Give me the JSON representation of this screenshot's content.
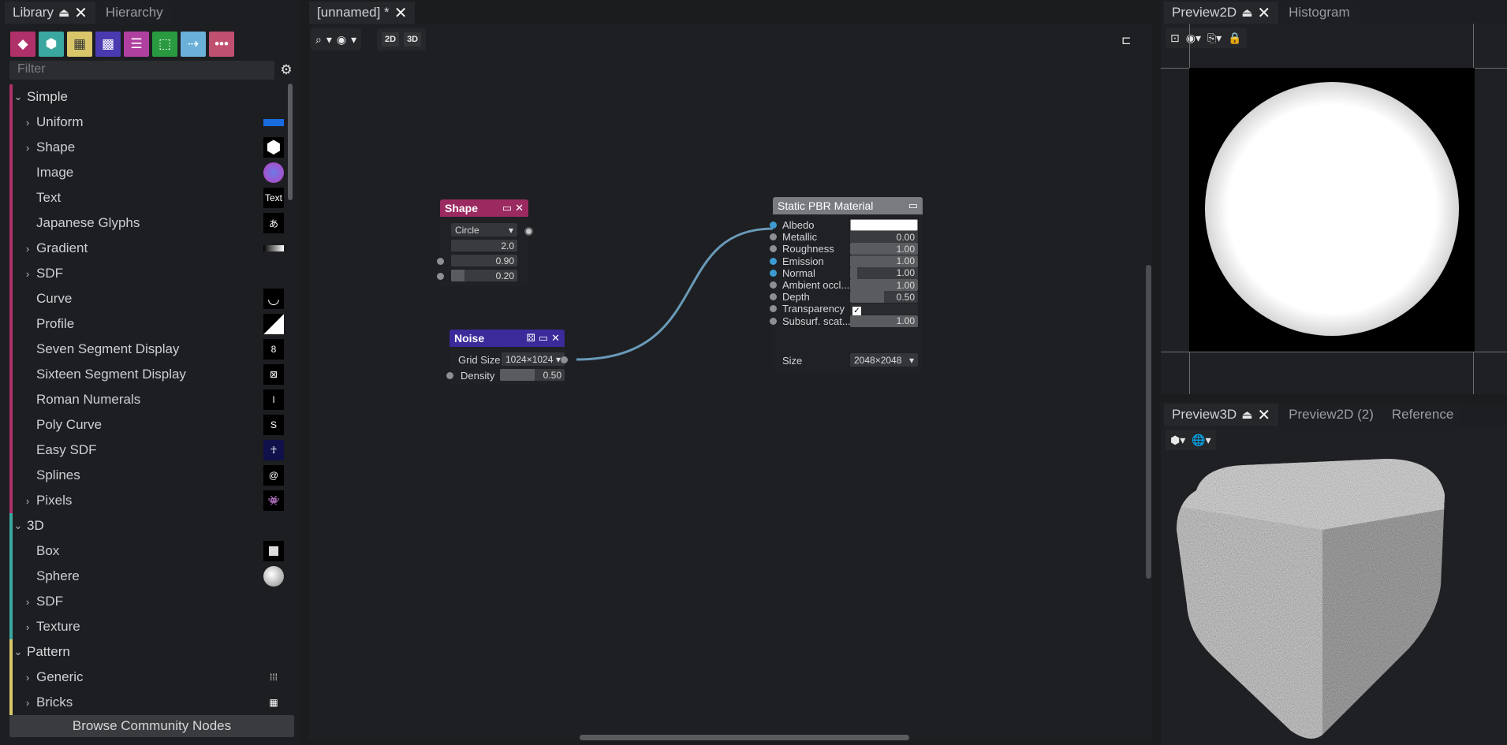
{
  "library_panel": {
    "tabs": [
      {
        "label": "Library",
        "active": true
      },
      {
        "label": "Hierarchy",
        "active": false
      }
    ],
    "filter_placeholder": "Filter",
    "category_icons": [
      {
        "name": "simple-shapes-icon",
        "color": "#b0306a"
      },
      {
        "name": "cube-icon",
        "color": "#3aa8a0"
      },
      {
        "name": "bricks-icon",
        "color": "#d9c66a"
      },
      {
        "name": "noise-icon",
        "color": "#4a3ab0"
      },
      {
        "name": "sliders-icon",
        "color": "#b040a0"
      },
      {
        "name": "selection-icon",
        "color": "#2a9a40"
      },
      {
        "name": "flow-icon",
        "color": "#6ab0d8"
      },
      {
        "name": "more-icon",
        "color": "#c05070"
      }
    ],
    "tree": [
      {
        "label": "Simple",
        "level": 0,
        "expanded": true,
        "color": "#b0306a"
      },
      {
        "label": "Uniform",
        "level": 1,
        "chev": true,
        "thumb": "uniform"
      },
      {
        "label": "Shape",
        "level": 1,
        "chev": true,
        "thumb": "hexagon"
      },
      {
        "label": "Image",
        "level": 1,
        "chev": false,
        "thumb": "image"
      },
      {
        "label": "Text",
        "level": 1,
        "chev": false,
        "thumb": "text",
        "thumb_text": "Text"
      },
      {
        "label": "Japanese Glyphs",
        "level": 1,
        "chev": false,
        "thumb": "glyph",
        "thumb_text": "あ"
      },
      {
        "label": "Gradient",
        "level": 1,
        "chev": true,
        "thumb": "gradient"
      },
      {
        "label": "SDF",
        "level": 1,
        "chev": true,
        "thumb": "none"
      },
      {
        "label": "Curve",
        "level": 1,
        "chev": false,
        "thumb": "curve"
      },
      {
        "label": "Profile",
        "level": 1,
        "chev": false,
        "thumb": "profile"
      },
      {
        "label": "Seven Segment Display",
        "level": 1,
        "chev": false,
        "thumb": "seg",
        "thumb_text": "8"
      },
      {
        "label": "Sixteen Segment Display",
        "level": 1,
        "chev": false,
        "thumb": "seg16",
        "thumb_text": "⊠"
      },
      {
        "label": "Roman Numerals",
        "level": 1,
        "chev": false,
        "thumb": "roman",
        "thumb_text": "I"
      },
      {
        "label": "Poly Curve",
        "level": 1,
        "chev": false,
        "thumb": "poly",
        "thumb_text": "S"
      },
      {
        "label": "Easy SDF",
        "level": 1,
        "chev": false,
        "thumb": "easysdf",
        "thumb_text": "☥"
      },
      {
        "label": "Splines",
        "level": 1,
        "chev": false,
        "thumb": "splines",
        "thumb_text": "@"
      },
      {
        "label": "Pixels",
        "level": 1,
        "chev": true,
        "thumb": "pixels",
        "thumb_text": "👾"
      },
      {
        "label": "3D",
        "level": 0,
        "expanded": true,
        "color": "#3aa8a0"
      },
      {
        "label": "Box",
        "level": 1,
        "chev": false,
        "thumb": "box"
      },
      {
        "label": "Sphere",
        "level": 1,
        "chev": false,
        "thumb": "sphere"
      },
      {
        "label": "SDF",
        "level": 1,
        "chev": true,
        "thumb": "none"
      },
      {
        "label": "Texture",
        "level": 1,
        "chev": true,
        "thumb": "none"
      },
      {
        "label": "Pattern",
        "level": 0,
        "expanded": true,
        "color": "#d9c66a"
      },
      {
        "label": "Generic",
        "level": 1,
        "chev": true,
        "thumb": "dots",
        "thumb_text": "⁞⁞⁞"
      },
      {
        "label": "Bricks",
        "level": 1,
        "chev": true,
        "thumb": "bricks",
        "thumb_text": "▦"
      }
    ],
    "browse_label": "Browse Community Nodes"
  },
  "graph": {
    "tab_label": "[unnamed] *",
    "toolbar": {
      "btn_2d": "2D",
      "btn_3d": "3D"
    },
    "nodes": {
      "shape": {
        "title": "Shape",
        "dropdown": "Circle",
        "values": [
          "2.0",
          "0.90",
          "0.20"
        ],
        "fills": [
          0,
          0,
          0.2
        ],
        "color": "#9a2a60"
      },
      "noise": {
        "title": "Noise",
        "grid_label": "Grid Size",
        "grid_value": "1024×1024",
        "density_label": "Density",
        "density_value": "0.50",
        "density_fill": 0.5,
        "color": "#3a2a9a"
      },
      "pbr": {
        "title": "Static PBR Material",
        "color": "#7a7b80",
        "rows": [
          {
            "label": "Albedo",
            "value": "",
            "fill": 1.0
          },
          {
            "label": "Metallic",
            "value": "0.00",
            "fill": 0.0
          },
          {
            "label": "Roughness",
            "value": "1.00",
            "fill": 1.0
          },
          {
            "label": "Emission",
            "value": "1.00",
            "fill": 1.0
          },
          {
            "label": "Normal",
            "value": "1.00",
            "fill": 0.1
          },
          {
            "label": "Ambient occl...",
            "value": "1.00",
            "fill": 1.0
          },
          {
            "label": "Depth",
            "value": "0.50",
            "fill": 0.5
          },
          {
            "label": "Transparency",
            "value": "",
            "fill": 0
          },
          {
            "label": "Subsurf. scat...",
            "value": "1.00",
            "fill": 1.0
          }
        ],
        "size_label": "Size",
        "size_value": "2048×2048"
      }
    }
  },
  "preview2d_panel": {
    "tabs": [
      {
        "label": "Preview2D",
        "active": true
      },
      {
        "label": "Histogram",
        "active": false
      }
    ]
  },
  "preview3d_panel": {
    "tabs": [
      {
        "label": "Preview3D",
        "active": true
      },
      {
        "label": "Preview2D (2)",
        "active": false
      },
      {
        "label": "Reference",
        "active": false
      }
    ]
  }
}
